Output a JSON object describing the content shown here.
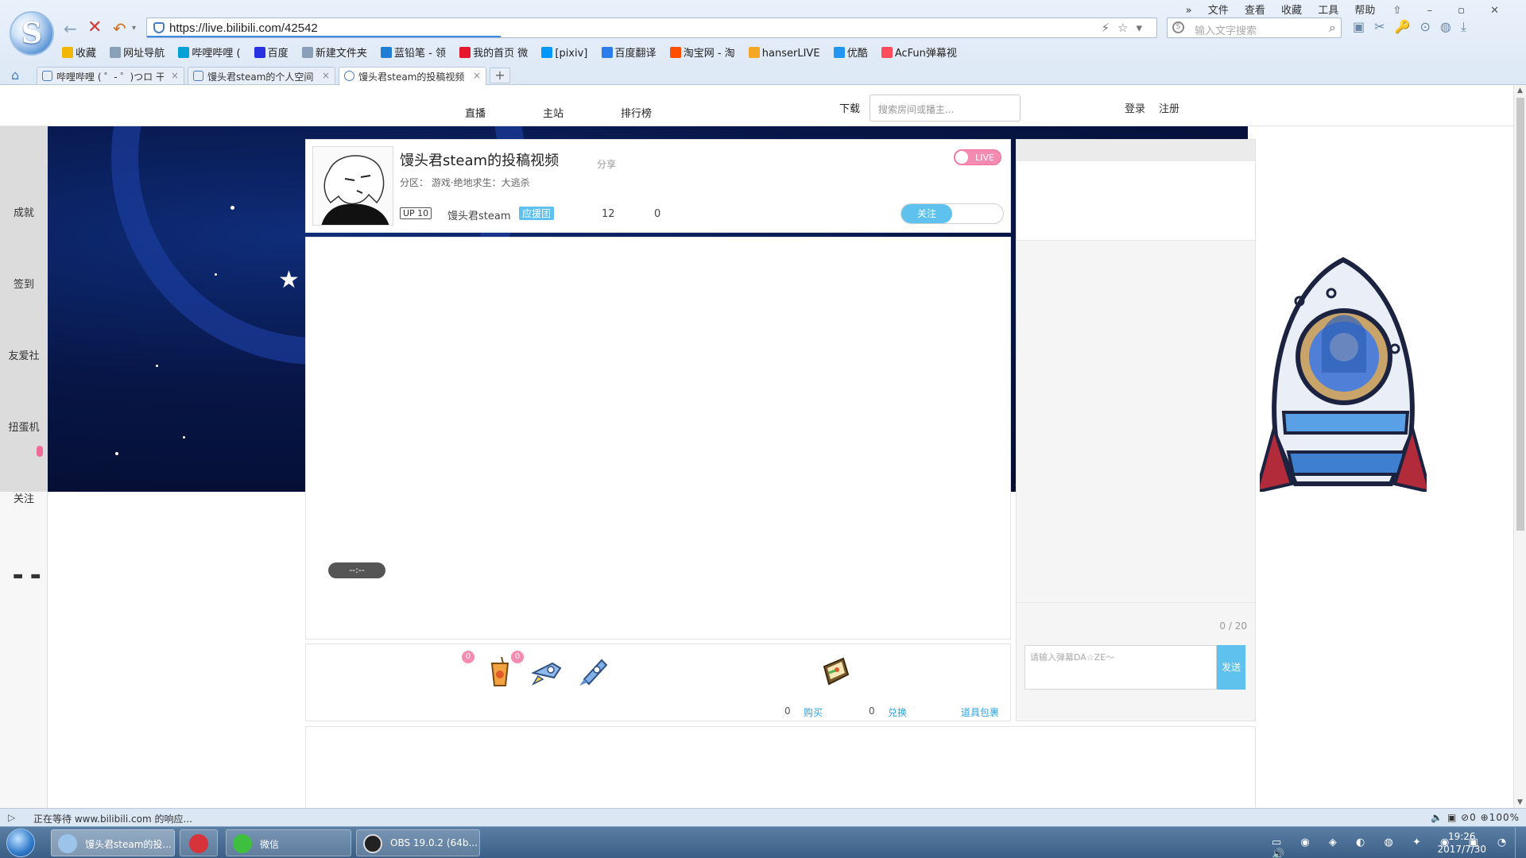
{
  "browser": {
    "logo_letter": "S",
    "url": "https://live.bilibili.com/42542",
    "search_placeholder": "输入文字搜索",
    "menu": [
      "文件",
      "查看",
      "收藏",
      "工具",
      "帮助"
    ],
    "menu_more": "»",
    "window_controls": "⇧ – ▫ ✕",
    "addr_tools": "⚡☆▾",
    "toolbar_icons": "▣✂🔑⊙◍⤓",
    "bookmarks": [
      {
        "label": "收藏",
        "color": "#f2b705"
      },
      {
        "label": "网址导航",
        "color": "#8aa0b8"
      },
      {
        "label": "哔哩哔哩 (",
        "color": "#00a1d6"
      },
      {
        "label": "百度",
        "color": "#2932e1"
      },
      {
        "label": "新建文件夹",
        "color": "#8aa0b8"
      },
      {
        "label": "蓝铅笔 - 领",
        "color": "#1e7ed3"
      },
      {
        "label": "我的首页 微",
        "color": "#e6162d"
      },
      {
        "label": "[pixiv]",
        "color": "#0096fa"
      },
      {
        "label": "百度翻译",
        "color": "#2b7de9"
      },
      {
        "label": "淘宝网 - 淘",
        "color": "#ff5000"
      },
      {
        "label": "hanserLIVE",
        "color": "#f5a623"
      },
      {
        "label": "优酷",
        "color": "#2196f3"
      },
      {
        "label": "AcFun弹幕视",
        "color": "#fd4c5d"
      }
    ],
    "tabs": [
      {
        "label": "哔哩哔哩 ( ゜- ゜)つロ 干"
      },
      {
        "label": "馒头君steam的个人空间"
      },
      {
        "label": "馒头君steam的投稿视频"
      }
    ],
    "new_tab": "+",
    "status_text": "正在等待 www.bilibili.com 的响应...",
    "status_right": "🔈  ▣  ⊘0  ⊕100%"
  },
  "site": {
    "nav": [
      "直播",
      "主站",
      "排行榜"
    ],
    "download": "下载",
    "search_placeholder": "搜索房间或播主...",
    "login": "登录",
    "register": "注册",
    "sidenav": [
      "成就",
      "签到",
      "友爱社",
      "扭蛋机",
      "关注"
    ],
    "sidenav_dash": "▬ ▬"
  },
  "room": {
    "title": "馒头君steam的投稿视频",
    "share": "分享",
    "area": "分区： 游戏·绝地求生：大逃杀",
    "up_level": "UP 10",
    "up_name": "馒头君steam",
    "fan_badge": "应援团",
    "stat_1": "12",
    "stat_2": "0",
    "live_label": "LIVE",
    "follow_label": "关注"
  },
  "player": {
    "time": "--:--"
  },
  "gifts": {
    "badge_1": "0",
    "badge_2": "0",
    "count_left": "0",
    "buy": "购买",
    "count_right": "0",
    "exchange": "兑换",
    "package": "道具包裹"
  },
  "chat": {
    "counter": "0 / 20",
    "input_placeholder": "请输入弹幕DA☆ZE～",
    "send": "发送"
  },
  "taskbar": {
    "items": [
      {
        "label": "馒头君steam的投..."
      },
      {
        "label": ""
      },
      {
        "label": "微信"
      },
      {
        "label": "OBS 19.0.2 (64b..."
      }
    ],
    "tray_icons": "▭ ◉ ◈ ◐ ◍ ✦ ◉ ▣ ◔ 🔊",
    "time": "19:26",
    "date": "2017/7/30"
  }
}
